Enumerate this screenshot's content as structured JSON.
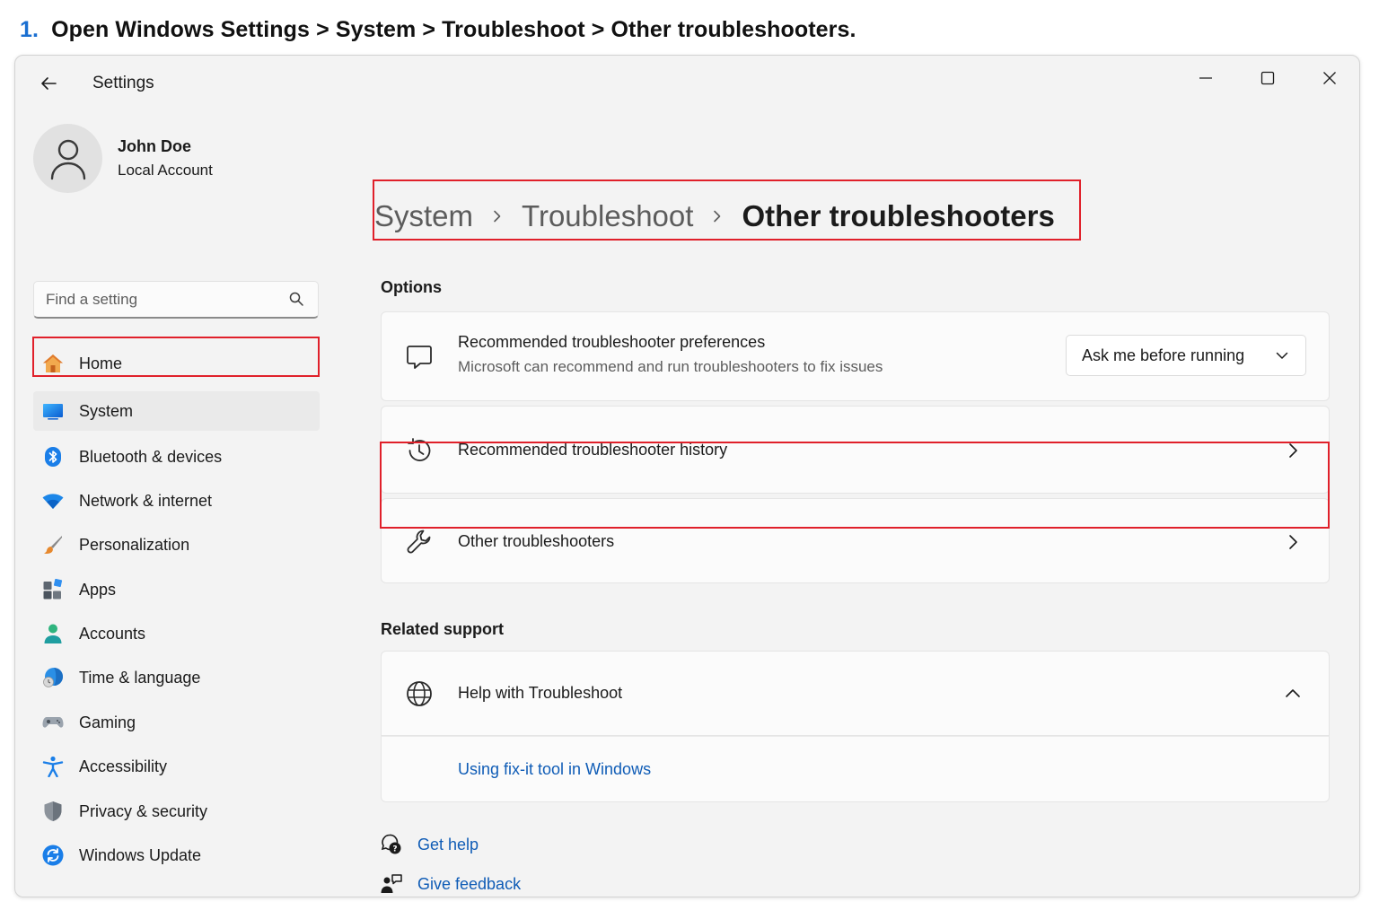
{
  "instruction": {
    "step": "1.",
    "text": "Open Windows Settings > System > Troubleshoot > Other troubleshooters."
  },
  "window": {
    "title": "Settings"
  },
  "profile": {
    "name": "John Doe",
    "account_type": "Local Account"
  },
  "search": {
    "placeholder": "Find a setting"
  },
  "sidebar": {
    "items": [
      {
        "label": "Home",
        "icon": "home-icon"
      },
      {
        "label": "System",
        "icon": "system-icon"
      },
      {
        "label": "Bluetooth & devices",
        "icon": "bluetooth-icon"
      },
      {
        "label": "Network & internet",
        "icon": "wifi-icon"
      },
      {
        "label": "Personalization",
        "icon": "brush-icon"
      },
      {
        "label": "Apps",
        "icon": "apps-icon"
      },
      {
        "label": "Accounts",
        "icon": "person-icon"
      },
      {
        "label": "Time & language",
        "icon": "globe-clock-icon"
      },
      {
        "label": "Gaming",
        "icon": "gamepad-icon"
      },
      {
        "label": "Accessibility",
        "icon": "accessibility-icon"
      },
      {
        "label": "Privacy & security",
        "icon": "shield-icon"
      },
      {
        "label": "Windows Update",
        "icon": "update-icon"
      }
    ],
    "active": "System"
  },
  "breadcrumb": {
    "items": [
      "System",
      "Troubleshoot"
    ],
    "current": "Other troubleshooters"
  },
  "options": {
    "heading": "Options",
    "preferences": {
      "title": "Recommended troubleshooter preferences",
      "subtitle": "Microsoft can recommend and run troubleshooters to fix issues",
      "dropdown_value": "Ask me before running"
    },
    "history": {
      "title": "Recommended troubleshooter history"
    },
    "other": {
      "title": "Other troubleshooters"
    }
  },
  "related_support": {
    "heading": "Related support",
    "help": {
      "title": "Help with Troubleshoot",
      "link": "Using fix-it tool in Windows"
    }
  },
  "footer_links": {
    "get_help": "Get help",
    "give_feedback": "Give feedback"
  },
  "colors": {
    "highlight": "#e0202a",
    "accent": "#0f5cb6",
    "step_number": "#1a6fd1",
    "window_bg": "#f3f3f3"
  }
}
